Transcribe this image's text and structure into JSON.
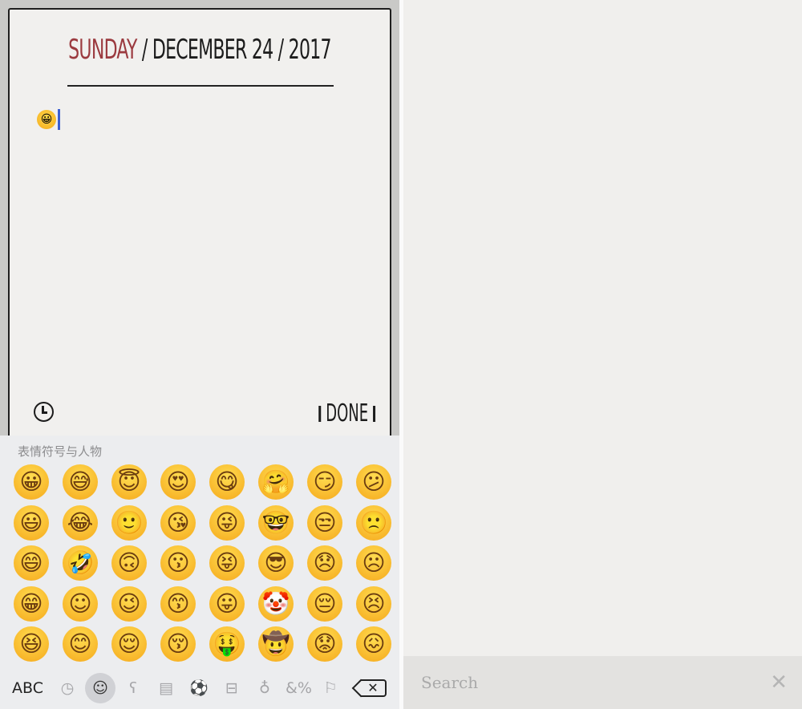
{
  "journal": {
    "day": "SUNDAY",
    "date_rest": " / DECEMBER 24 / 2017",
    "entry_emoji": "😀",
    "done_label": "DONE"
  },
  "keyboard": {
    "category_title": "表情符号与人物",
    "emoji_rows": [
      [
        "😀",
        "😅",
        "😇",
        "😍",
        "😋",
        "🤗",
        "😏",
        "😕"
      ],
      [
        "😃",
        "😂",
        "🙂",
        "😘",
        "😜",
        "🤓",
        "😒",
        "🙁"
      ],
      [
        "😄",
        "🤣",
        "🙃",
        "😗",
        "😝",
        "😎",
        "😞",
        "☹"
      ],
      [
        "😁",
        "☺",
        "😉",
        "😙",
        "😛",
        "🤡",
        "😔",
        "😣"
      ],
      [
        "😆",
        "😊",
        "😌",
        "😚",
        "🤑",
        "🤠",
        "😟",
        "😖"
      ]
    ],
    "abc_label": "ABC",
    "tabs": [
      {
        "icon": "clock-icon",
        "glyph": "◷"
      },
      {
        "icon": "smiley-icon",
        "glyph": "☺",
        "selected": true
      },
      {
        "icon": "bear-icon",
        "glyph": "ʕ"
      },
      {
        "icon": "food-icon",
        "glyph": "▤"
      },
      {
        "icon": "ball-icon",
        "glyph": "⚽"
      },
      {
        "icon": "car-icon",
        "glyph": "⊟"
      },
      {
        "icon": "lightbulb-icon",
        "glyph": "♁"
      },
      {
        "icon": "symbols-icon",
        "glyph": "&%"
      },
      {
        "icon": "flag-icon",
        "glyph": "⚐"
      }
    ]
  },
  "search": {
    "placeholder": "Search",
    "clear_glyph": "✕"
  }
}
